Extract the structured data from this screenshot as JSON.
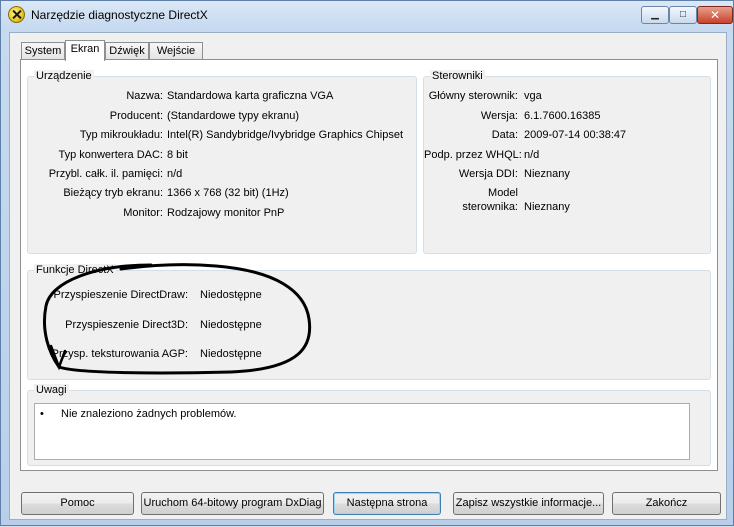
{
  "window": {
    "title": "Narzędzie diagnostyczne DirectX",
    "minimize_glyph": "▁",
    "maximize_glyph": "□",
    "close_glyph": "✕",
    "app_icon": "directx-icon"
  },
  "tabs": [
    {
      "label": "System",
      "active": false
    },
    {
      "label": "Ekran",
      "active": true
    },
    {
      "label": "Dźwięk",
      "active": false
    },
    {
      "label": "Wejście",
      "active": false
    }
  ],
  "device": {
    "title": "Urządzenie",
    "rows": [
      {
        "label": "Nazwa:",
        "value": "Standardowa karta graficzna VGA"
      },
      {
        "label": "Producent:",
        "value": "(Standardowe typy ekranu)"
      },
      {
        "label": "Typ mikroukładu:",
        "value": "Intel(R) Sandybridge/Ivybridge Graphics Chipset"
      },
      {
        "label": "Typ konwertera DAC:",
        "value": "8 bit"
      },
      {
        "label": "Przybl. całk. il. pamięci:",
        "value": "n/d"
      },
      {
        "label": "Bieżący tryb ekranu:",
        "value": "1366 x 768 (32 bit) (1Hz)"
      },
      {
        "label": "Monitor:",
        "value": "Rodzajowy monitor PnP"
      }
    ]
  },
  "drivers": {
    "title": "Sterowniki",
    "rows": [
      {
        "label": "Główny sterownik:",
        "value": "vga"
      },
      {
        "label": "Wersja:",
        "value": "6.1.7600.16385"
      },
      {
        "label": "Data:",
        "value": "2009-07-14 00:38:47"
      },
      {
        "label": "Podp. przez WHQL:",
        "value": "n/d"
      },
      {
        "label": "Wersja DDI:",
        "value": "Nieznany"
      },
      {
        "label_line1": "Model",
        "label_line2": "sterownika:",
        "value": "Nieznany"
      }
    ]
  },
  "features": {
    "title": "Funkcje DirectX",
    "rows": [
      {
        "label": "Przyspieszenie DirectDraw:",
        "value": "Niedostępne"
      },
      {
        "label": "Przyspieszenie Direct3D:",
        "value": "Niedostępne"
      },
      {
        "label": "Przysp. teksturowania AGP:",
        "value": "Niedostępne"
      }
    ]
  },
  "notes": {
    "title": "Uwagi",
    "bullet": "•",
    "text": "Nie znaleziono żadnych problemów."
  },
  "buttons": {
    "help": "Pomoc",
    "run64": "Uruchom 64-bitowy program DxDiag",
    "next": "Następna strona",
    "save": "Zapisz wszystkie informacje...",
    "exit": "Zakończ"
  },
  "colors": {
    "annotation_ink": "#000000",
    "title_gradient_top": "#dbe8f6",
    "close_button": "#c8422a"
  }
}
